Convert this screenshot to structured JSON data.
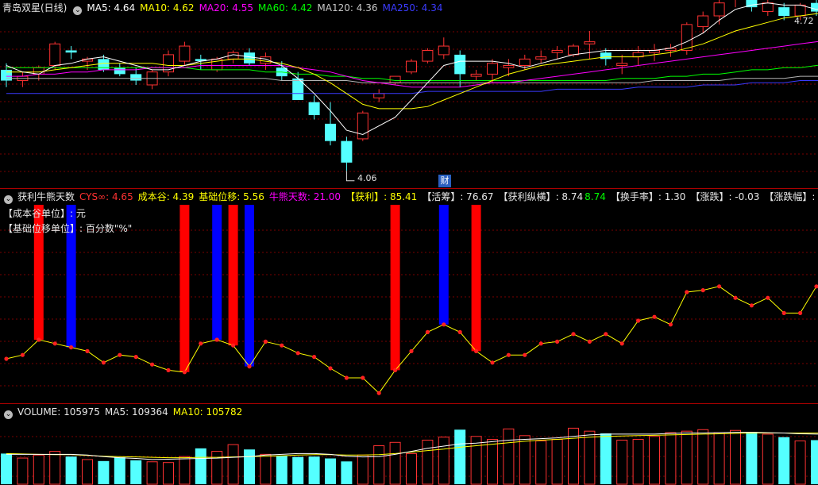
{
  "title_bar": {
    "stock_name": "青岛双星(日线)",
    "ma5": "MA5: 4.64",
    "ma10": "MA10: 4.62",
    "ma20": "MA20: 4.55",
    "ma60": "MA60: 4.42",
    "ma120": "MA120: 4.36",
    "ma250": "MA250: 4.34"
  },
  "price_labels": {
    "high": "4.72",
    "low": "4.06",
    "event_badge": "财"
  },
  "indicator_bar": {
    "name": "获利牛熊天数",
    "cys": "CYS∞: 4.65",
    "cost_valley": "成本谷: 4.39",
    "base_shift": "基础位移: 5.56",
    "bull_bear_days": "牛熊天数: 21.00",
    "profit_label": "【获利】",
    "profit_value": ": 85.41",
    "active_label": "【活筹】",
    "active_value": ": 76.67",
    "profit_span_label": "【获利纵横】",
    "profit_span_value1": ": 8.74",
    "profit_span_value2": "8.74",
    "turnover": "【换手率】: 1.30",
    "change": "【涨跌】: -0.03",
    "change_pct": "【涨跌幅】: -0.64"
  },
  "notes": {
    "cost_unit": "【成本谷单位】: 元",
    "shift_unit": "【基础位移单位】: 百分数\"%\""
  },
  "volume_bar": {
    "volume": "VOLUME: 105975",
    "ma5": "MA5: 109364",
    "ma10": "MA10: 105782"
  },
  "colors": {
    "up": "#ff3232",
    "down": "#54ffff",
    "ma5": "#ffffff",
    "ma10": "#ffff00",
    "ma20": "#ff00ff",
    "ma60": "#00ff00",
    "ma120": "#b4b4b4",
    "ma250": "#3b3bff",
    "grid": "#7a0000",
    "divider": "#aa0000",
    "signal_red": "#ff0000",
    "signal_blue": "#0000ff"
  },
  "chart_data": {
    "type": "candlestick",
    "price_ylim": [
      4.0,
      4.78
    ],
    "candles": [
      [
        4.53,
        4.56,
        4.45,
        4.48
      ],
      [
        4.48,
        4.52,
        4.45,
        4.5
      ],
      [
        4.51,
        4.55,
        4.48,
        4.54
      ],
      [
        4.55,
        4.66,
        4.53,
        4.65
      ],
      [
        4.62,
        4.64,
        4.58,
        4.61
      ],
      [
        4.57,
        4.59,
        4.53,
        4.58
      ],
      [
        4.58,
        4.6,
        4.52,
        4.53
      ],
      [
        4.54,
        4.56,
        4.5,
        4.51
      ],
      [
        4.51,
        4.54,
        4.46,
        4.48
      ],
      [
        4.46,
        4.53,
        4.44,
        4.52
      ],
      [
        4.52,
        4.62,
        4.5,
        4.6
      ],
      [
        4.57,
        4.66,
        4.55,
        4.64
      ],
      [
        4.58,
        4.6,
        4.53,
        4.57
      ],
      [
        4.53,
        4.59,
        4.52,
        4.58
      ],
      [
        4.58,
        4.62,
        4.56,
        4.61
      ],
      [
        4.61,
        4.63,
        4.55,
        4.56
      ],
      [
        4.56,
        4.61,
        4.53,
        4.59
      ],
      [
        4.54,
        4.57,
        4.48,
        4.5
      ],
      [
        4.49,
        4.52,
        4.39,
        4.39
      ],
      [
        4.38,
        4.41,
        4.3,
        4.32
      ],
      [
        4.28,
        4.38,
        4.18,
        4.2
      ],
      [
        4.2,
        4.22,
        4.06,
        4.1
      ],
      [
        4.21,
        4.34,
        4.2,
        4.33
      ],
      [
        4.4,
        4.44,
        4.38,
        4.42
      ],
      [
        4.47,
        4.5,
        4.46,
        4.5
      ],
      [
        4.52,
        4.58,
        4.51,
        4.57
      ],
      [
        4.57,
        4.63,
        4.56,
        4.62
      ],
      [
        4.6,
        4.68,
        4.58,
        4.64
      ],
      [
        4.6,
        4.62,
        4.45,
        4.51
      ],
      [
        4.5,
        4.53,
        4.48,
        4.51
      ],
      [
        4.51,
        4.58,
        4.47,
        4.56
      ],
      [
        4.54,
        4.58,
        4.5,
        4.55
      ],
      [
        4.55,
        4.6,
        4.53,
        4.58
      ],
      [
        4.58,
        4.62,
        4.56,
        4.59
      ],
      [
        4.61,
        4.64,
        4.58,
        4.62
      ],
      [
        4.6,
        4.65,
        4.59,
        4.64
      ],
      [
        4.65,
        4.71,
        4.58,
        4.66
      ],
      [
        4.61,
        4.63,
        4.55,
        4.58
      ],
      [
        4.55,
        4.6,
        4.51,
        4.56
      ],
      [
        4.59,
        4.64,
        4.55,
        4.61
      ],
      [
        4.61,
        4.65,
        4.57,
        4.62
      ],
      [
        4.62,
        4.65,
        4.59,
        4.63
      ],
      [
        4.62,
        4.75,
        4.6,
        4.74
      ],
      [
        4.73,
        4.8,
        4.7,
        4.78
      ],
      [
        4.78,
        4.86,
        4.74,
        4.84
      ],
      [
        4.86,
        4.9,
        4.82,
        4.89
      ],
      [
        4.86,
        4.88,
        4.8,
        4.82
      ],
      [
        4.8,
        4.86,
        4.78,
        4.84
      ],
      [
        4.82,
        4.84,
        4.76,
        4.78
      ],
      [
        4.78,
        4.84,
        4.76,
        4.83
      ],
      [
        4.84,
        4.86,
        4.78,
        4.8
      ],
      [
        4.78,
        4.84,
        4.76,
        4.83
      ],
      [
        4.82,
        4.86,
        4.78,
        4.84
      ],
      [
        4.86,
        4.88,
        4.82,
        4.84
      ],
      [
        4.83,
        4.9,
        4.8,
        4.88
      ],
      [
        4.92,
        4.96,
        4.86,
        4.94
      ],
      [
        4.92,
        4.98,
        4.85,
        4.87
      ],
      [
        4.88,
        4.92,
        4.68,
        4.72
      ]
    ],
    "ma5": [
      4.55,
      4.52,
      4.51,
      4.55,
      4.56,
      4.58,
      4.59,
      4.57,
      4.55,
      4.53,
      4.53,
      4.55,
      4.57,
      4.58,
      4.6,
      4.59,
      4.58,
      4.55,
      4.49,
      4.42,
      4.34,
      4.25,
      4.23,
      4.27,
      4.31,
      4.39,
      4.47,
      4.55,
      4.57,
      4.57,
      4.57,
      4.56,
      4.54,
      4.56,
      4.58,
      4.6,
      4.61,
      4.62,
      4.62,
      4.62,
      4.62,
      4.63,
      4.66,
      4.7,
      4.76,
      4.81,
      4.83,
      4.84,
      4.83,
      4.83,
      4.81,
      4.82,
      4.82,
      4.83,
      4.84,
      4.86,
      4.88,
      4.84
    ],
    "ma10": [
      4.52,
      4.52,
      4.52,
      4.53,
      4.54,
      4.55,
      4.56,
      4.56,
      4.56,
      4.56,
      4.55,
      4.55,
      4.56,
      4.57,
      4.58,
      4.58,
      4.57,
      4.56,
      4.54,
      4.51,
      4.47,
      4.42,
      4.37,
      4.35,
      4.35,
      4.35,
      4.36,
      4.39,
      4.42,
      4.45,
      4.48,
      4.51,
      4.53,
      4.55,
      4.56,
      4.57,
      4.58,
      4.59,
      4.59,
      4.59,
      4.6,
      4.61,
      4.63,
      4.65,
      4.68,
      4.71,
      4.73,
      4.75,
      4.77,
      4.78,
      4.79,
      4.8,
      4.81,
      4.82,
      4.83,
      4.84,
      4.85,
      4.85
    ],
    "ma20": [
      4.5,
      4.5,
      4.51,
      4.51,
      4.52,
      4.52,
      4.53,
      4.53,
      4.53,
      4.54,
      4.54,
      4.54,
      4.55,
      4.55,
      4.55,
      4.55,
      4.55,
      4.55,
      4.54,
      4.53,
      4.52,
      4.5,
      4.48,
      4.47,
      4.46,
      4.45,
      4.45,
      4.45,
      4.45,
      4.46,
      4.47,
      4.47,
      4.48,
      4.49,
      4.5,
      4.51,
      4.52,
      4.53,
      4.54,
      4.55,
      4.56,
      4.57,
      4.58,
      4.59,
      4.6,
      4.61,
      4.62,
      4.63,
      4.64,
      4.65,
      4.66,
      4.67,
      4.68,
      4.69,
      4.7,
      4.71,
      4.72,
      4.72
    ],
    "ma60": [
      4.54,
      4.54,
      4.54,
      4.54,
      4.54,
      4.54,
      4.54,
      4.54,
      4.54,
      4.54,
      4.54,
      4.54,
      4.53,
      4.53,
      4.53,
      4.53,
      4.52,
      4.52,
      4.51,
      4.51,
      4.5,
      4.5,
      4.49,
      4.49,
      4.48,
      4.48,
      4.48,
      4.48,
      4.48,
      4.48,
      4.48,
      4.48,
      4.48,
      4.48,
      4.48,
      4.48,
      4.48,
      4.48,
      4.49,
      4.49,
      4.49,
      4.5,
      4.5,
      4.51,
      4.51,
      4.52,
      4.53,
      4.53,
      4.54,
      4.54,
      4.55,
      4.56,
      4.56,
      4.57,
      4.57,
      4.58,
      4.58,
      4.59
    ],
    "ma120": [
      4.49,
      4.49,
      4.49,
      4.49,
      4.49,
      4.49,
      4.49,
      4.49,
      4.49,
      4.49,
      4.49,
      4.49,
      4.49,
      4.49,
      4.49,
      4.49,
      4.49,
      4.48,
      4.48,
      4.48,
      4.48,
      4.48,
      4.47,
      4.47,
      4.47,
      4.47,
      4.47,
      4.47,
      4.47,
      4.47,
      4.47,
      4.47,
      4.47,
      4.47,
      4.47,
      4.47,
      4.47,
      4.47,
      4.47,
      4.47,
      4.48,
      4.48,
      4.48,
      4.48,
      4.48,
      4.49,
      4.49,
      4.49,
      4.49,
      4.5,
      4.5,
      4.5,
      4.5,
      4.51,
      4.51,
      4.51,
      4.52,
      4.52
    ],
    "ma250": [
      4.42,
      4.42,
      4.42,
      4.42,
      4.42,
      4.42,
      4.42,
      4.42,
      4.42,
      4.42,
      4.42,
      4.42,
      4.42,
      4.42,
      4.42,
      4.42,
      4.42,
      4.42,
      4.42,
      4.42,
      4.42,
      4.42,
      4.42,
      4.42,
      4.42,
      4.42,
      4.43,
      4.43,
      4.43,
      4.43,
      4.43,
      4.43,
      4.43,
      4.43,
      4.44,
      4.44,
      4.44,
      4.44,
      4.44,
      4.45,
      4.45,
      4.45,
      4.45,
      4.46,
      4.46,
      4.46,
      4.47,
      4.47,
      4.47,
      4.48,
      4.48,
      4.48,
      4.49,
      4.49,
      4.49,
      4.5,
      4.5,
      4.5
    ],
    "indicator_ylim": [
      0,
      100
    ],
    "indicator": [
      20,
      22,
      30,
      28,
      26,
      24,
      18,
      22,
      21,
      17,
      14,
      13,
      28,
      30,
      27,
      16,
      29,
      27,
      23,
      21,
      15,
      10,
      10,
      2,
      14,
      24,
      34,
      38,
      34,
      24,
      18,
      22,
      22,
      28,
      29,
      33,
      29,
      33,
      28,
      40,
      42,
      38,
      55,
      56,
      58,
      52,
      48,
      52,
      44,
      44,
      58,
      60,
      58,
      58,
      62,
      61,
      58,
      55
    ],
    "indicator_signals": [
      {
        "index": 2,
        "color": "red"
      },
      {
        "index": 4,
        "color": "blue"
      },
      {
        "index": 11,
        "color": "red"
      },
      {
        "index": 13,
        "color": "blue"
      },
      {
        "index": 14,
        "color": "red"
      },
      {
        "index": 15,
        "color": "blue"
      },
      {
        "index": 24,
        "color": "red"
      },
      {
        "index": 27,
        "color": "blue"
      },
      {
        "index": 29,
        "color": "red"
      }
    ],
    "volume_ylim": [
      0,
      170000
    ],
    "volume": [
      82000,
      70000,
      78000,
      88000,
      74000,
      66000,
      62000,
      72000,
      64000,
      60000,
      58000,
      74000,
      96000,
      88000,
      106000,
      93000,
      80000,
      76000,
      73000,
      74000,
      69000,
      61000,
      78000,
      103000,
      112000,
      82000,
      118000,
      126000,
      146000,
      128000,
      120000,
      148000,
      130000,
      116000,
      120000,
      150000,
      142000,
      136000,
      118000,
      120000,
      128000,
      138000,
      142000,
      146000,
      138000,
      144000,
      140000,
      134000,
      126000,
      116000,
      118000,
      132000,
      128000,
      146000,
      122000,
      150000,
      120000,
      138000
    ],
    "volume_ma5": [
      80000,
      80000,
      80000,
      80000,
      80000,
      78000,
      74000,
      71000,
      69000,
      66000,
      67000,
      68000,
      69000,
      70000,
      72000,
      74000,
      78000,
      80000,
      82000,
      82000,
      80000,
      75000,
      73000,
      74000,
      80000,
      88000,
      96000,
      102000,
      108000,
      110000,
      114000,
      118000,
      120000,
      122000,
      124000,
      128000,
      132000,
      134000,
      134000,
      134000,
      134000,
      136000,
      137000,
      137000,
      138000,
      139000,
      139000,
      138000,
      137000,
      135000,
      134000,
      134000,
      134000,
      134000,
      134000,
      135000,
      135000,
      135000
    ],
    "volume_ma10": [
      82000,
      81000,
      80000,
      79000,
      79000,
      77000,
      75000,
      74000,
      73000,
      72000,
      71000,
      71000,
      72000,
      72000,
      73000,
      74000,
      75000,
      76000,
      78000,
      79000,
      79000,
      78000,
      78000,
      79000,
      82000,
      86000,
      90000,
      94000,
      99000,
      103000,
      107000,
      111000,
      115000,
      118000,
      120000,
      123000,
      126000,
      128000,
      129000,
      130000,
      131000,
      132000,
      133000,
      134000,
      135000,
      136000,
      137000,
      137000,
      137000,
      137000,
      137000,
      137000,
      137000,
      137000,
      137000,
      137000,
      137000,
      137000
    ]
  }
}
